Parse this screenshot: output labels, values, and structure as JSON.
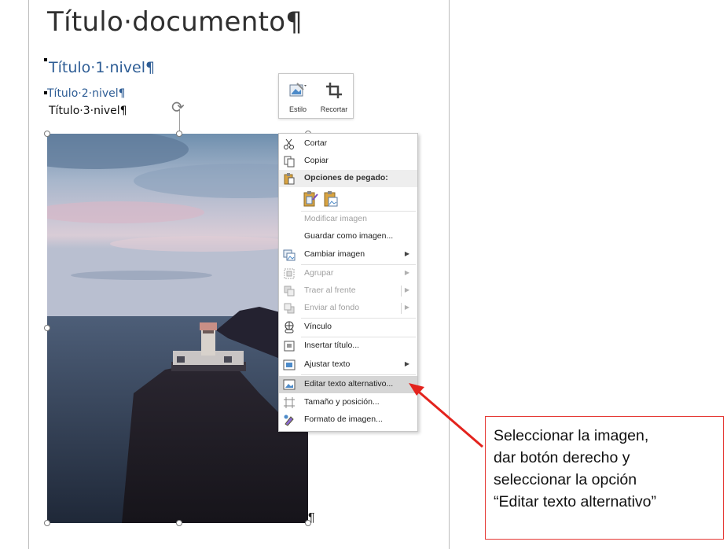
{
  "document": {
    "title": "Título·documento¶",
    "h1": "Título·1·nivel¶",
    "h2": "Título·2·nivel¶",
    "h3": "Título·3·nivel¶",
    "end_mark": "¶"
  },
  "mini_toolbar": {
    "style_label": "Estilo",
    "crop_label": "Recortar"
  },
  "context_menu": {
    "cut": "Cortar",
    "copy": "Copiar",
    "paste_options": "Opciones de pegado:",
    "modify_image": "Modificar imagen",
    "save_as_image": "Guardar como imagen...",
    "change_image": "Cambiar imagen",
    "group": "Agrupar",
    "bring_front": "Traer al frente",
    "send_back": "Enviar al fondo",
    "link": "Vínculo",
    "insert_caption": "Insertar título...",
    "wrap_text": "Ajustar texto",
    "edit_alt_text": "Editar texto alternativo...",
    "size_position": "Tamaño y posición...",
    "format_image": "Formato de imagen..."
  },
  "callout": {
    "line1": "Seleccionar la imagen,",
    "line2": "dar botón derecho y",
    "line3": "seleccionar la opción",
    "line4": "“Editar texto alternativo”"
  },
  "colors": {
    "heading_blue": "#2e5d95",
    "arrow_red": "#e3231d",
    "highlight": "#d6d6d6"
  }
}
